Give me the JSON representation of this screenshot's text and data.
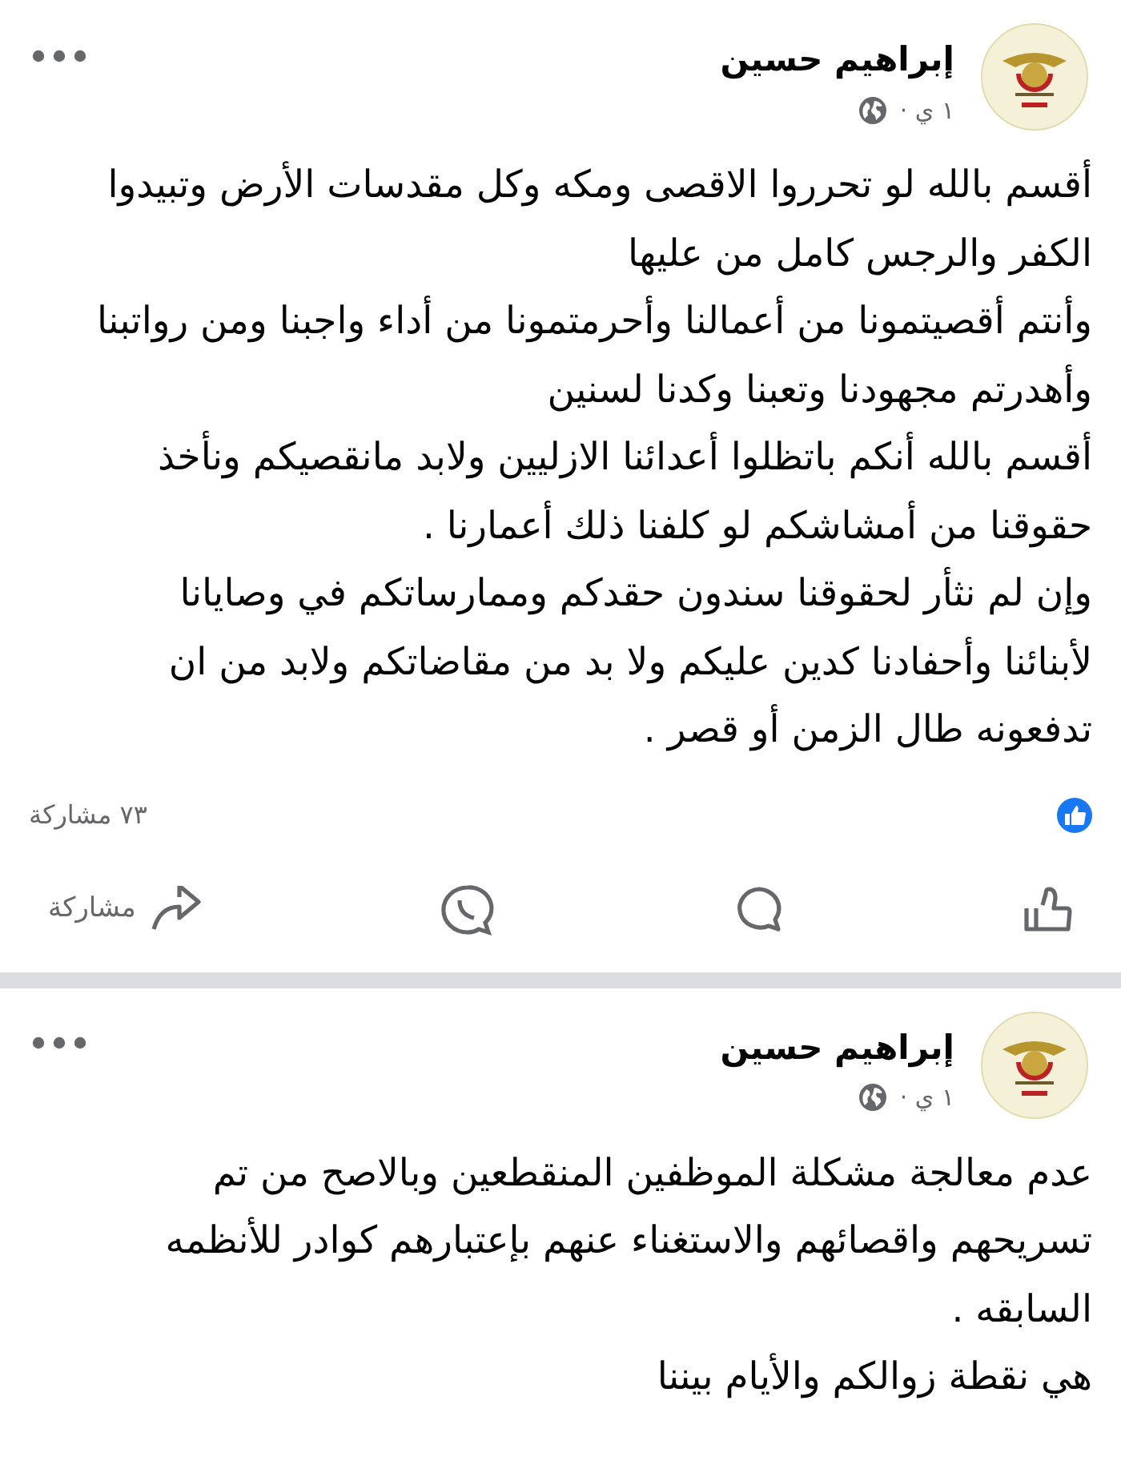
{
  "posts": [
    {
      "author": "إبراهيم حسين",
      "time": "١ ي ·",
      "lines": [
        "أقسم بالله لو تحرروا الاقصى ومكه وكل مقدسات الأرض وتبيدوا",
        "الكفر والرجس كامل من عليها",
        "وأنتم أقصيتمونا من أعمالنا وأحرمتمونا من أداء واجبنا ومن رواتبنا",
        "وأهدرتم مجهودنا وتعبنا وكدنا لسنين",
        "أقسم بالله أنكم باتظلوا أعدائنا الازليين ولابد مانقصيكم ونأخذ",
        "حقوقنا من أمشاشكم  لو كلفنا ذلك أعمارنا .",
        "وإن لم نثأر لحقوقنا سندون حقدكم وممارساتكم في وصايانا",
        "لأبنائنا وأحفادنا كدين عليكم ولا بد من مقاضاتكم ولابد من ان",
        "تدفعونه طال الزمن أو قصر ."
      ],
      "stats": {
        "shares": "٧٣ مشاركة"
      },
      "actions": [
        {
          "kind": "like"
        },
        {
          "kind": "comment"
        },
        {
          "kind": "send"
        },
        {
          "kind": "share",
          "label": "مشاركة"
        }
      ]
    },
    {
      "author": "إبراهيم حسين",
      "time": "١ ي ·",
      "lines": [
        "عدم معالجة مشكلة الموظفين المنقطعين وبالاصح من تم",
        "تسريحهم واقصائهم والاستغناء عنهم بإعتبارهم كوادر للأنظمه",
        "السابقه .",
        "هي نقطة زوالكم والأيام بيننا"
      ]
    }
  ]
}
